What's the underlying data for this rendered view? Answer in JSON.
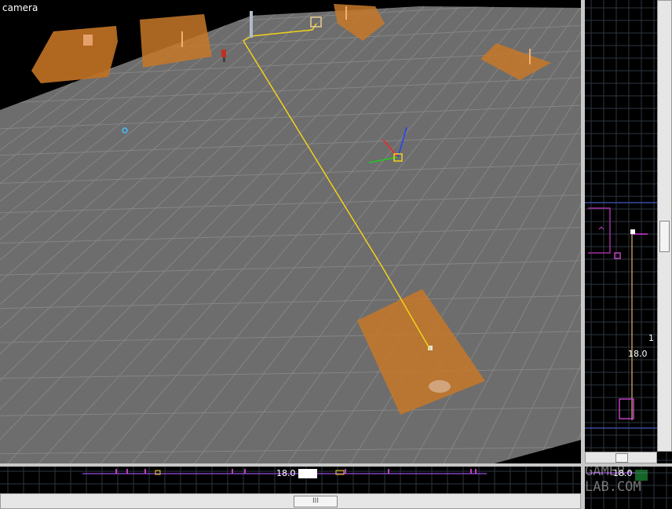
{
  "camera_view": {
    "label": "camera"
  },
  "side_view": {
    "readout_top": "1",
    "readout_value": "18.0"
  },
  "bottom_view": {
    "readout_value": "18.0",
    "scroll_grip": "III"
  },
  "corner_view": {
    "readout_value": "18.0"
  },
  "watermark": "GAMER-LAB.COM",
  "colors": {
    "floor": "#6d6d6d",
    "grid": "#858585",
    "zone_fill": "#c77828",
    "path": "#f2d21a",
    "side_grid": "#2c3640",
    "axis_x": "#ff2020",
    "axis_y": "#20cc20",
    "axis_z": "#2040ff"
  }
}
